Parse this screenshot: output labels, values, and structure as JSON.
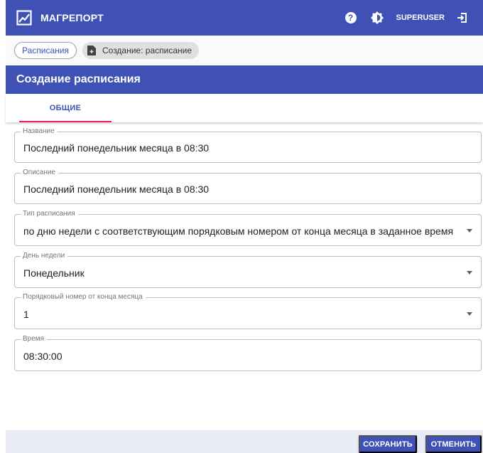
{
  "app": {
    "brand": "МАГРЕПОРТ",
    "help_glyph": "?",
    "user": "SUPERUSER"
  },
  "breadcrumbs": {
    "items": [
      {
        "label": "Расписания"
      },
      {
        "label": "Создание: расписание"
      }
    ]
  },
  "page": {
    "title": "Создание расписания"
  },
  "tabs": [
    {
      "label": "ОБЩИЕ",
      "active": true
    }
  ],
  "form": {
    "name": {
      "label": "Название",
      "value": "Последний понедельник месяца в 08:30"
    },
    "description": {
      "label": "Описание",
      "value": "Последний понедельник месяца в 08:30"
    },
    "schedule_type": {
      "label": "Тип расписания",
      "value": "по дню недели с соответствующим порядковым номером от конца месяца в заданное время"
    },
    "weekday": {
      "label": "День недели",
      "value": "Понедельник"
    },
    "ordinal": {
      "label": "Порядковый номер от конца месяца",
      "value": "1"
    },
    "time": {
      "label": "Время",
      "value": "08:30:00"
    }
  },
  "actions": {
    "save": "СОХРАНИТЬ",
    "cancel": "ОТМЕНИТЬ"
  },
  "colors": {
    "primary": "#3f51b5",
    "tab_indicator": "#e91e63",
    "footer_bg": "#e8eaf6"
  }
}
